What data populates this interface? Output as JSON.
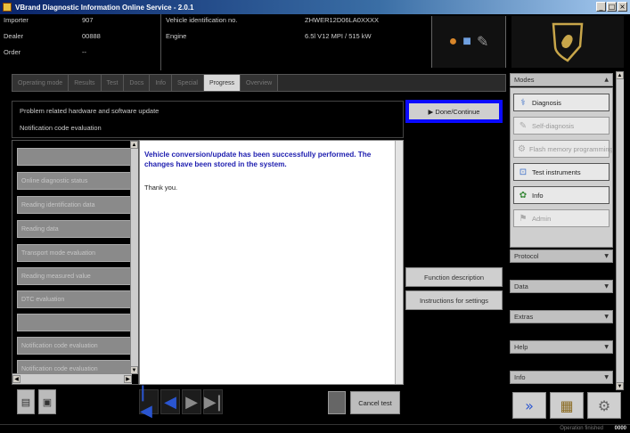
{
  "window": {
    "title": "VBrand Diagnostic Information Online Service - 2.0.1",
    "min_label": "_",
    "max_label": "□",
    "close_label": "×"
  },
  "header": {
    "importer_label": "Importer",
    "importer_value": "907",
    "dealer_label": "Dealer",
    "dealer_value": "00888",
    "order_label": "Order",
    "order_value": "--",
    "vehicle_id_label": "Vehicle identification no.",
    "vehicle_id_value": "ZHWER12D06LA0XXXX",
    "engine_label": "Engine",
    "engine_value": "6.5l V12 MPI / 515 kW"
  },
  "tabs": [
    {
      "label": "Operating mode"
    },
    {
      "label": "Results"
    },
    {
      "label": "Test"
    },
    {
      "label": "Docs"
    },
    {
      "label": "Info"
    },
    {
      "label": "Special"
    },
    {
      "label": "Progress"
    },
    {
      "label": "Overview"
    }
  ],
  "infobar": {
    "line1": "Problem related hardware and software update",
    "line2": "Notification code evaluation"
  },
  "actions": {
    "done_label": "▶  Done/Continue",
    "function_desc_label": "Function description",
    "instructions_label": "Instructions for settings"
  },
  "left_list": [
    {
      "label": ""
    },
    {
      "label": "Online diagnostic status"
    },
    {
      "label": "Reading identification data"
    },
    {
      "label": "Reading data"
    },
    {
      "label": "Transport mode evaluation"
    },
    {
      "label": "Reading measured value"
    },
    {
      "label": "DTC evaluation"
    },
    {
      "label": ""
    },
    {
      "label": "Notification code evaluation"
    },
    {
      "label": "Notification code evaluation"
    }
  ],
  "main": {
    "message": "Vehicle conversion/update has been successfully performed. The changes have been stored in the system.",
    "thanks": "Thank you."
  },
  "bottom": {
    "nav_first": "|◀",
    "nav_prev": "◀",
    "nav_next": "▶",
    "nav_last": "▶|",
    "cancel_label": "Cancel test"
  },
  "right_panel": {
    "modes_label": "Modes",
    "modes": [
      {
        "label": "Diagnosis",
        "enabled": true,
        "icon": "stethoscope-icon"
      },
      {
        "label": "Self-diagnosis",
        "enabled": false,
        "icon": "wrench-icon"
      },
      {
        "label": "Flash memory programming",
        "enabled": false,
        "icon": "chip-icon"
      },
      {
        "label": "Test instruments",
        "enabled": true,
        "icon": "meter-icon"
      },
      {
        "label": "Info",
        "enabled": true,
        "icon": "info-icon"
      },
      {
        "label": "Admin",
        "enabled": false,
        "icon": "admin-icon"
      }
    ],
    "protocol_label": "Protocol",
    "data_label": "Data",
    "extras_label": "Extras",
    "help_label": "Help",
    "info_label": "Info"
  },
  "status": {
    "text": "Operation finished",
    "version": "0000"
  },
  "colors": {
    "highlight": "#0a0aff",
    "message": "#2020b0",
    "nav_active": "#2a55d0"
  }
}
